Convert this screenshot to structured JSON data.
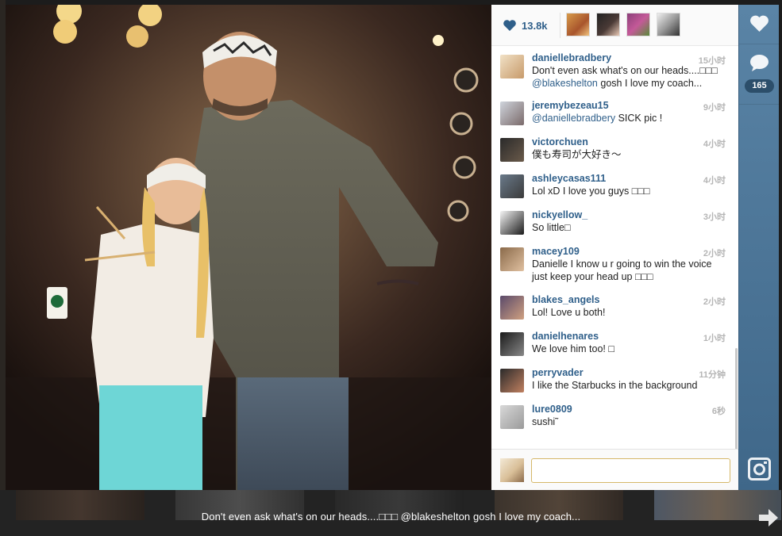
{
  "photo": {
    "caption": "Don't even ask what's on our heads....□□□ @blakeshelton gosh I love my coach..."
  },
  "likes": {
    "count": "13.8k"
  },
  "comments": [
    {
      "user": "daniellebradbery",
      "time": "15小时",
      "text_parts": [
        "Don't even ask what's on our heads....□□□ ",
        "@blakeshelton",
        " gosh I love my coach..."
      ],
      "avatar_colors": [
        "#f1e1c6",
        "#c79a6a"
      ]
    },
    {
      "user": "jeremybezeau15",
      "time": "9小时",
      "text_parts": [
        "",
        "@daniellebradbery",
        " SICK pic !"
      ],
      "avatar_colors": [
        "#cfd4dc",
        "#7a6a6a"
      ]
    },
    {
      "user": "victorchuen",
      "time": "4小时",
      "text_parts": [
        "僕も寿司が大好き〜",
        "",
        ""
      ],
      "avatar_colors": [
        "#2a2a2a",
        "#6a5a4a"
      ]
    },
    {
      "user": "ashleycasas111",
      "time": "4小时",
      "text_parts": [
        "Lol xD I love you guys □□□",
        "",
        ""
      ],
      "avatar_colors": [
        "#6a7a8a",
        "#3a3a3a"
      ]
    },
    {
      "user": "nickyellow_",
      "time": "3小时",
      "text_parts": [
        "So little□",
        "",
        ""
      ],
      "avatar_colors": [
        "#f5f5f5",
        "#1a1a1a"
      ]
    },
    {
      "user": "macey109",
      "time": "2小时",
      "text_parts": [
        "Danielle I know u r going to win the voice just keep your head up □□□",
        "",
        ""
      ],
      "avatar_colors": [
        "#8a6a4a",
        "#e0c0a0"
      ]
    },
    {
      "user": "blakes_angels",
      "time": "2小时",
      "text_parts": [
        "Lol! Love u both!",
        "",
        ""
      ],
      "avatar_colors": [
        "#5a4a6a",
        "#d0a080"
      ]
    },
    {
      "user": "danielhenares",
      "time": "1小时",
      "text_parts": [
        "We love him too! □",
        "",
        ""
      ],
      "avatar_colors": [
        "#1a1a1a",
        "#888888"
      ]
    },
    {
      "user": "perryvader",
      "time": "11分钟",
      "text_parts": [
        "I like the Starbucks in the background",
        "",
        ""
      ],
      "avatar_colors": [
        "#2a2a2a",
        "#c08060"
      ]
    },
    {
      "user": "lure0809",
      "time": "6秒",
      "text_parts": [
        "sushi˜",
        "",
        ""
      ],
      "avatar_colors": [
        "#d8d8d8",
        "#9a9a9a"
      ]
    }
  ],
  "compose": {
    "placeholder": ""
  },
  "actions": {
    "comment_count": "165"
  },
  "colors": {
    "accent": "#2f5f8a",
    "sidebar": "#4a739a",
    "input_border": "#d6b86a"
  }
}
